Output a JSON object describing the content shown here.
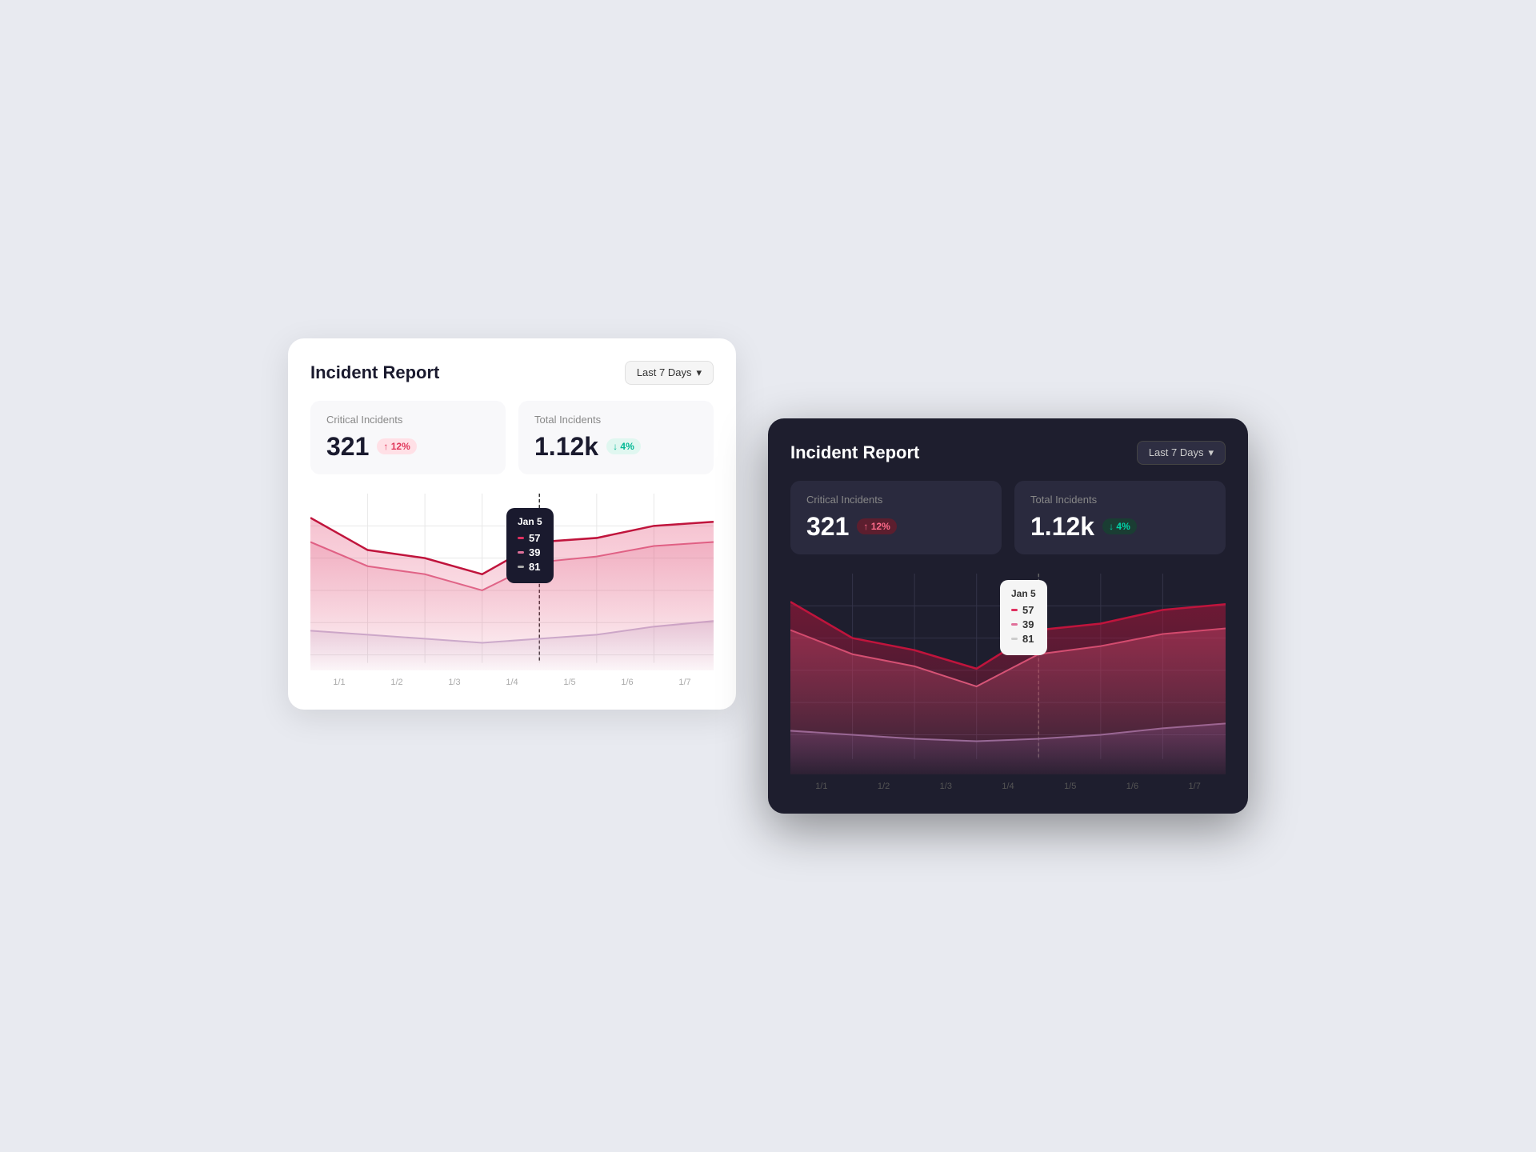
{
  "light_card": {
    "title": "Incident Report",
    "date_btn": "Last 7 Days",
    "stats": {
      "critical": {
        "label": "Critical Incidents",
        "value": "321",
        "badge": "↑ 12%",
        "badge_type": "up"
      },
      "total": {
        "label": "Total Incidents",
        "value": "1.12k",
        "badge": "↓ 4%",
        "badge_type": "down"
      }
    },
    "tooltip": {
      "date": "Jan 5",
      "line1": "57",
      "line2": "39",
      "line3": "81"
    },
    "x_labels": [
      "1/1",
      "1/2",
      "1/3",
      "1/4",
      "1/5",
      "1/6",
      "1/7"
    ]
  },
  "dark_card": {
    "title": "Incident Report",
    "date_btn": "Last 7 Days",
    "stats": {
      "critical": {
        "label": "Critical Incidents",
        "value": "321",
        "badge": "↑ 12%",
        "badge_type": "up"
      },
      "total": {
        "label": "Total Incidents",
        "value": "1.12k",
        "badge": "↓ 4%",
        "badge_type": "down"
      }
    },
    "tooltip": {
      "date": "Jan 5",
      "line1": "57",
      "line2": "39",
      "line3": "81"
    },
    "x_labels": [
      "1/1",
      "1/2",
      "1/3",
      "1/4",
      "1/5",
      "1/6",
      "1/7"
    ]
  },
  "colors": {
    "bg": "#e8eaf0",
    "line1": "#c0143c",
    "line2": "#e07090",
    "line3_light": "#c0b0c8",
    "line3_dark": "#6a5a7a"
  }
}
